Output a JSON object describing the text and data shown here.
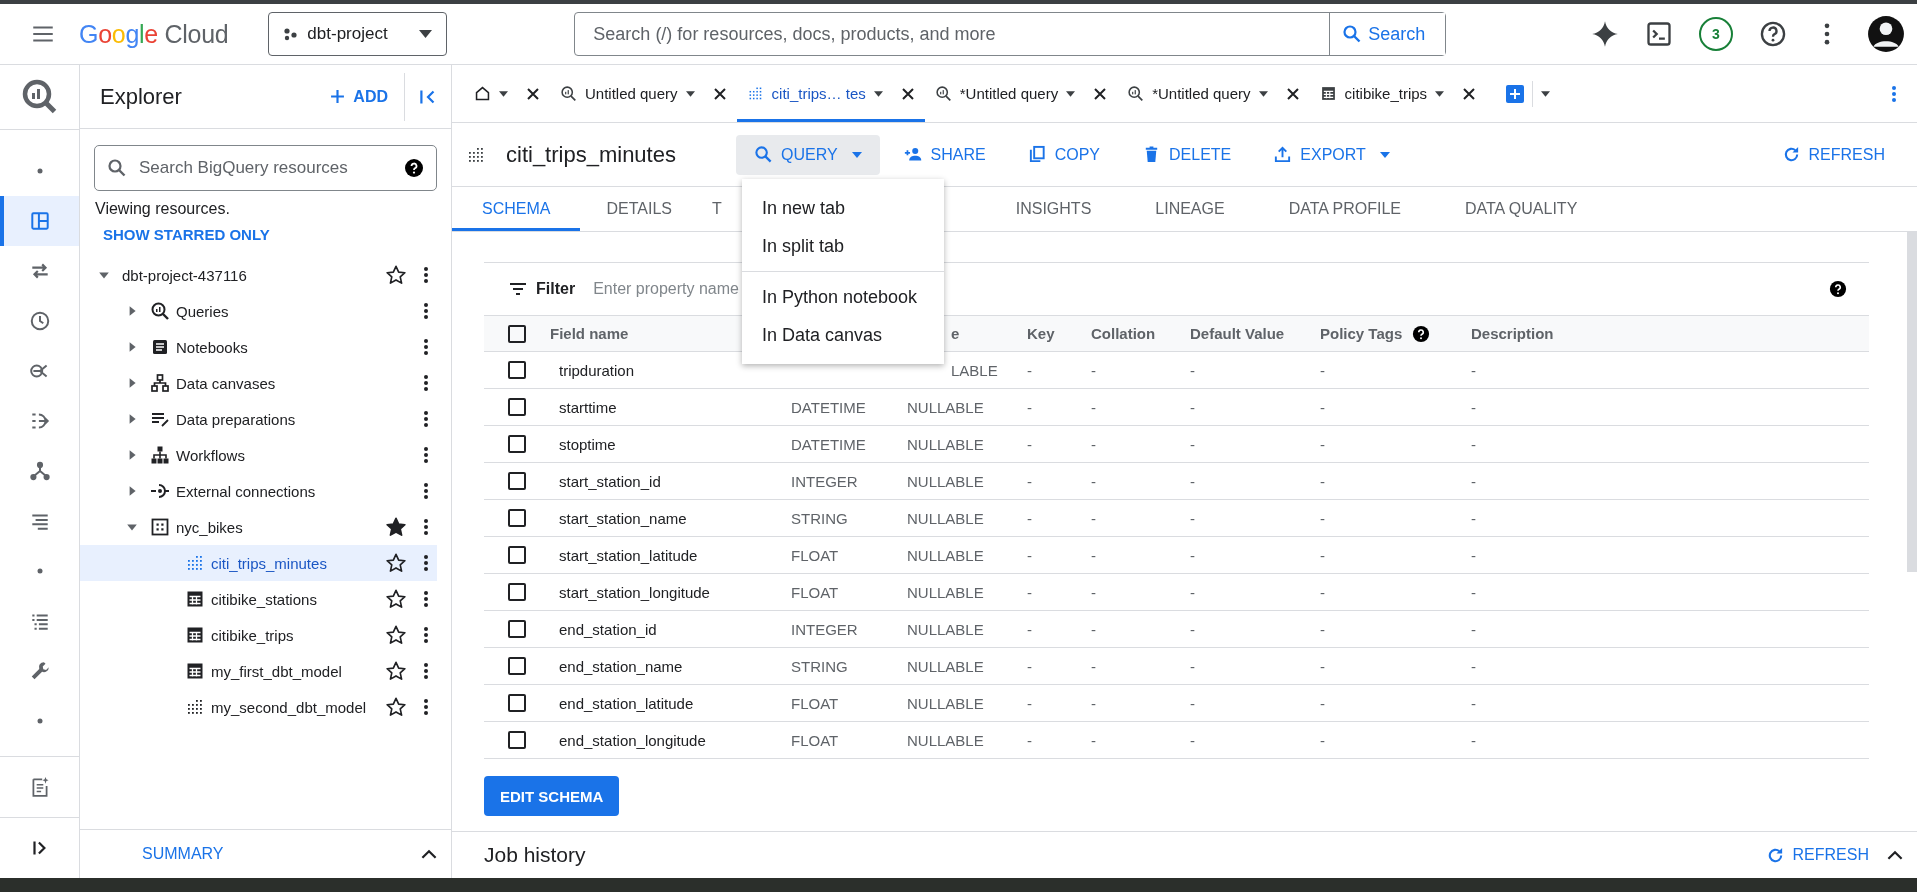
{
  "header": {
    "brand": "Google",
    "product": "Cloud",
    "project": "dbt-project",
    "search_placeholder": "Search (/) for resources, docs, products, and more",
    "search_button": "Search",
    "notification_count": "3"
  },
  "rail": {
    "items": [
      {
        "kind": "dot",
        "selected": false
      },
      {
        "kind": "panel",
        "selected": true
      },
      {
        "kind": "transfer",
        "selected": false
      },
      {
        "kind": "clock",
        "selected": false
      },
      {
        "kind": "graph",
        "selected": false
      },
      {
        "kind": "pipeline",
        "selected": false
      },
      {
        "kind": "tree",
        "selected": false
      },
      {
        "kind": "lines",
        "selected": false
      },
      {
        "kind": "dot",
        "selected": false
      },
      {
        "kind": "list",
        "selected": false
      },
      {
        "kind": "wrench",
        "selected": false
      },
      {
        "kind": "dot",
        "selected": false
      }
    ]
  },
  "explorer": {
    "title": "Explorer",
    "add": "ADD",
    "search_placeholder": "Search BigQuery resources",
    "viewing": "Viewing resources.",
    "starred_link": "SHOW STARRED ONLY",
    "tree": [
      {
        "label": "dbt-project-437116",
        "kind": "project",
        "expanded": true,
        "starred": false,
        "children": [
          {
            "label": "Queries",
            "kind": "queries",
            "expanded": false
          },
          {
            "label": "Notebooks",
            "kind": "notebooks",
            "expanded": false
          },
          {
            "label": "Data canvases",
            "kind": "canvases",
            "expanded": false
          },
          {
            "label": "Data preparations",
            "kind": "preparations",
            "expanded": false
          },
          {
            "label": "Workflows",
            "kind": "workflows",
            "expanded": false
          },
          {
            "label": "External connections",
            "kind": "connections",
            "expanded": false
          },
          {
            "label": "nyc_bikes",
            "kind": "dataset",
            "expanded": true,
            "starred": true,
            "children": [
              {
                "label": "citi_trips_minutes",
                "kind": "view",
                "starred": false,
                "selected": true
              },
              {
                "label": "citibike_stations",
                "kind": "table",
                "starred": false,
                "selected": false
              },
              {
                "label": "citibike_trips",
                "kind": "table",
                "starred": false,
                "selected": false
              },
              {
                "label": "my_first_dbt_model",
                "kind": "table",
                "starred": false,
                "selected": false
              },
              {
                "label": "my_second_dbt_model",
                "kind": "view",
                "starred": false,
                "selected": false
              }
            ]
          }
        ]
      }
    ],
    "summary": "SUMMARY"
  },
  "tabs": [
    {
      "kind": "home",
      "selected": false
    },
    {
      "kind": "query",
      "label": "Untitled query",
      "selected": false
    },
    {
      "kind": "view",
      "label": "citi_trips… tes",
      "selected": true
    },
    {
      "kind": "query",
      "label": "*Untitled query",
      "selected": false
    },
    {
      "kind": "query",
      "label": "*Untitled query",
      "selected": false
    },
    {
      "kind": "table",
      "label": "citibike_trips",
      "selected": false
    }
  ],
  "toolbar": {
    "title": "citi_trips_minutes",
    "actions": [
      {
        "kind": "query",
        "label": "QUERY",
        "dropdown": true,
        "pressed": true
      },
      {
        "kind": "share",
        "label": "SHARE",
        "dropdown": false,
        "pressed": false
      },
      {
        "kind": "copy",
        "label": "COPY",
        "dropdown": false,
        "pressed": false
      },
      {
        "kind": "delete",
        "label": "DELETE",
        "dropdown": false,
        "pressed": false
      },
      {
        "kind": "export",
        "label": "EXPORT",
        "dropdown": true,
        "pressed": false
      }
    ],
    "refresh": "REFRESH"
  },
  "query_menu": {
    "items": [
      {
        "label": "In new tab",
        "separator_before": false
      },
      {
        "label": "In split tab",
        "separator_before": false
      },
      {
        "label": "In Python notebook",
        "separator_before": true
      },
      {
        "label": "In Data canvas",
        "separator_before": false
      }
    ]
  },
  "subtabs": [
    {
      "label": "SCHEMA",
      "selected": true,
      "clipped": false
    },
    {
      "label": "DETAILS",
      "selected": false,
      "clipped": false
    },
    {
      "label": "T",
      "selected": false,
      "clipped": true
    },
    {
      "label": "INSIGHTS",
      "selected": false,
      "clipped": false
    },
    {
      "label": "LINEAGE",
      "selected": false,
      "clipped": false
    },
    {
      "label": "DATA PROFILE",
      "selected": false,
      "clipped": false
    },
    {
      "label": "DATA QUALITY",
      "selected": false,
      "clipped": false
    }
  ],
  "schema": {
    "filter_label": "Filter",
    "filter_placeholder": "Enter property name",
    "columns": {
      "name": "Field name",
      "mode": "e",
      "key": "Key",
      "collation": "Collation",
      "default": "Default Value",
      "policy": "Policy Tags",
      "description": "Description"
    },
    "header_checked": false,
    "rows": [
      {
        "name": "tripduration",
        "mode": "LABLE",
        "key": "-",
        "collation": "-",
        "default": "-",
        "policy": "-",
        "description": "-",
        "checked": false
      },
      {
        "name": "starttime",
        "type": "DATETIME",
        "mode": "NULLABLE",
        "key": "-",
        "collation": "-",
        "default": "-",
        "policy": "-",
        "description": "-",
        "checked": false
      },
      {
        "name": "stoptime",
        "type": "DATETIME",
        "mode": "NULLABLE",
        "key": "-",
        "collation": "-",
        "default": "-",
        "policy": "-",
        "description": "-",
        "checked": false
      },
      {
        "name": "start_station_id",
        "type": "INTEGER",
        "mode": "NULLABLE",
        "key": "-",
        "collation": "-",
        "default": "-",
        "policy": "-",
        "description": "-",
        "checked": false
      },
      {
        "name": "start_station_name",
        "type": "STRING",
        "mode": "NULLABLE",
        "key": "-",
        "collation": "-",
        "default": "-",
        "policy": "-",
        "description": "-",
        "checked": false
      },
      {
        "name": "start_station_latitude",
        "type": "FLOAT",
        "mode": "NULLABLE",
        "key": "-",
        "collation": "-",
        "default": "-",
        "policy": "-",
        "description": "-",
        "checked": false
      },
      {
        "name": "start_station_longitude",
        "type": "FLOAT",
        "mode": "NULLABLE",
        "key": "-",
        "collation": "-",
        "default": "-",
        "policy": "-",
        "description": "-",
        "checked": false
      },
      {
        "name": "end_station_id",
        "type": "INTEGER",
        "mode": "NULLABLE",
        "key": "-",
        "collation": "-",
        "default": "-",
        "policy": "-",
        "description": "-",
        "checked": false
      },
      {
        "name": "end_station_name",
        "type": "STRING",
        "mode": "NULLABLE",
        "key": "-",
        "collation": "-",
        "default": "-",
        "policy": "-",
        "description": "-",
        "checked": false
      },
      {
        "name": "end_station_latitude",
        "type": "FLOAT",
        "mode": "NULLABLE",
        "key": "-",
        "collation": "-",
        "default": "-",
        "policy": "-",
        "description": "-",
        "checked": false
      },
      {
        "name": "end_station_longitude",
        "type": "FLOAT",
        "mode": "NULLABLE",
        "key": "-",
        "collation": "-",
        "default": "-",
        "policy": "-",
        "description": "-",
        "checked": false
      }
    ],
    "edit_button": "EDIT SCHEMA"
  },
  "job_history": {
    "title": "Job history",
    "refresh": "REFRESH"
  }
}
